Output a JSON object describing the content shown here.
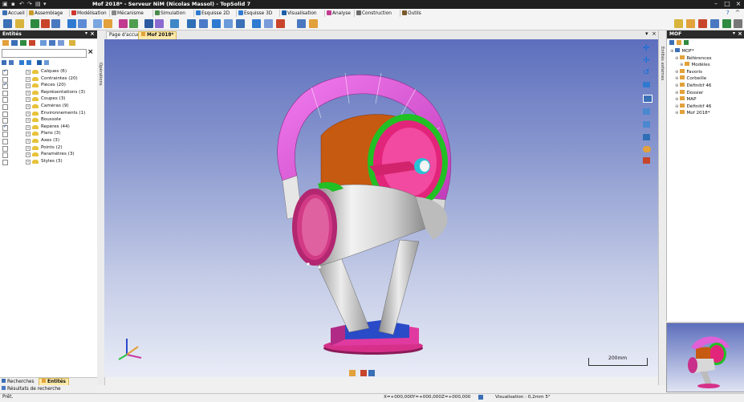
{
  "window": {
    "title": "Mof 2018* - Serveur NiM (Nicolas Massol) - TopSolid 7"
  },
  "menu": {
    "items": [
      "Accueil",
      "Assemblage",
      "Modélisation",
      "Mécanisme",
      "Simulation",
      "Esquisse 2D",
      "Esquisse 3D",
      "Visualisation",
      "Analyse",
      "Construction",
      "Outils"
    ]
  },
  "left_panel": {
    "title": "Entités",
    "tree": [
      {
        "label": "Calques (6)",
        "checked": true
      },
      {
        "label": "Contraintes (20)",
        "checked": false
      },
      {
        "label": "Pièces (20)",
        "checked": true
      },
      {
        "label": "Représentations (3)",
        "checked": false
      },
      {
        "label": "Coupes (3)",
        "checked": false
      },
      {
        "label": "Caméras (9)",
        "checked": false
      },
      {
        "label": "Environnements (1)",
        "checked": false
      },
      {
        "label": "Boussole",
        "checked": false
      },
      {
        "label": "Repères (44)",
        "checked": true
      },
      {
        "label": "Plans (3)",
        "checked": false
      },
      {
        "label": "Axes (3)",
        "checked": false
      },
      {
        "label": "Points (2)",
        "checked": false
      },
      {
        "label": "Paramètres (3)",
        "checked": false
      },
      {
        "label": "Styles (3)",
        "checked": false
      }
    ],
    "bottom_tabs": [
      "Recherches",
      "Entités"
    ],
    "search_results_tab": "Résultats de recherche"
  },
  "side_strips": {
    "left_label": "Opérations",
    "right_label": "Entités externes"
  },
  "doc_tabs": [
    "Page d'accueil",
    "Mof 2018*"
  ],
  "viewport": {
    "scale_label": "200mm"
  },
  "right_panel": {
    "title": "MOF",
    "tree": [
      {
        "label": "MOF*",
        "indent": 0
      },
      {
        "label": "Références",
        "indent": 1
      },
      {
        "label": "Modèles",
        "indent": 2
      },
      {
        "label": "Favoris",
        "indent": 1
      },
      {
        "label": "Corbeille",
        "indent": 1
      },
      {
        "label": "Définitif 46",
        "indent": 1
      },
      {
        "label": "Dossier",
        "indent": 1
      },
      {
        "label": "MAP",
        "indent": 1
      },
      {
        "label": "Définitif 46",
        "indent": 1
      },
      {
        "label": "Mof 2018*",
        "indent": 1
      }
    ]
  },
  "status": {
    "left": "Prêt.",
    "x": "X=+000,000",
    "y": "Y=+000,000",
    "z": "Z=+000,000",
    "visualisation": "Visualisation : 0,2mm 5°"
  },
  "colors": {
    "viewport_top": "#5d6fbd",
    "viewport_bottom": "#e9ecf7",
    "magenta": "#e060d8",
    "green": "#22c322",
    "orange": "#c85a12"
  }
}
